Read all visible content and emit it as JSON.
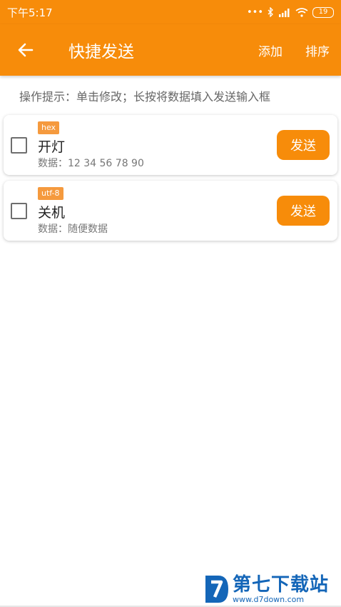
{
  "status": {
    "time": "下午5:17",
    "battery": "19"
  },
  "appbar": {
    "title": "快捷发送",
    "add_label": "添加",
    "sort_label": "排序"
  },
  "hint": "操作提示：单击修改；长按将数据填入发送输入框",
  "items": [
    {
      "type": "hex",
      "name": "开灯",
      "data": "数据：12 34 56 78 90",
      "send_label": "发送"
    },
    {
      "type": "utf-8",
      "name": "关机",
      "data": "数据：随便数据",
      "send_label": "发送"
    }
  ],
  "watermark": {
    "title": "第七下载站",
    "url": "www.d7down.com"
  },
  "colors": {
    "accent": "#f78c0a",
    "badge": "#f59a3e",
    "watermark": "#1466b8"
  }
}
